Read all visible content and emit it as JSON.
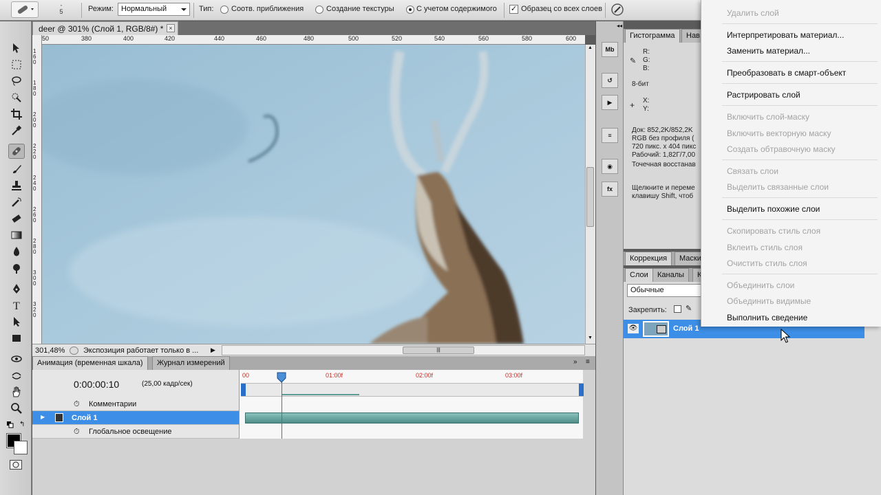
{
  "options_bar": {
    "brush_size": "5",
    "mode_label": "Режим:",
    "mode_value": "Нормальный",
    "type_label": "Тип:",
    "type_options": [
      "Соотв. приближения",
      "Создание текстуры",
      "С учетом содержимого"
    ],
    "sample_all_layers": "Образец со всех слоев"
  },
  "document": {
    "tab_title": "deer @ 301% (Слой 1, RGB/8#) *",
    "close_label": "×",
    "ruler_top": [
      "50",
      "380",
      "400",
      "420",
      "440",
      "460",
      "480",
      "500",
      "520",
      "540",
      "560",
      "580",
      "600"
    ],
    "ruler_left": [
      "160",
      "180",
      "200",
      "220",
      "240",
      "260",
      "280",
      "300",
      "320"
    ],
    "zoom": "301,48%",
    "status_text": "Экспозиция работает только в ..."
  },
  "timeline": {
    "tabs": [
      "Анимация (временная шкала)",
      "Журнал измерений"
    ],
    "time": "0:00:00:10",
    "fps": "(25,00 кадр/сек)",
    "ruler": [
      "00",
      "01:00f",
      "02:00f",
      "03:00f"
    ],
    "rows": {
      "comments": "Комментарии",
      "layer": "Слой 1",
      "global_light": "Глобальное освещение"
    }
  },
  "right_panel": {
    "tabs_top": [
      "Гистограмма",
      "Нав"
    ],
    "info": {
      "r": "R:",
      "g": "G:",
      "b": "B:",
      "bits": "8-бит",
      "x": "X:",
      "y": "Y:",
      "doc": "Док: 852,2K/852,2K",
      "profile": "RGB без профиля (",
      "size": "720 пикс. x 404 пикс",
      "work": "Рабочий: 1,82Г/7,00",
      "tool": "Точечная восстанав",
      "hint1": "Щелкните и переме",
      "hint2": "клавишу Shift, чтоб"
    },
    "adj_tabs": [
      "Коррекция",
      "Маски"
    ],
    "layers_tabs": [
      "Слои",
      "Каналы",
      "К"
    ],
    "blend_mode": "Обычные",
    "lock_label": "Закрепить:",
    "layer_name": "Слой 1"
  },
  "context_menu": {
    "items": [
      {
        "label": "Удалить слой",
        "disabled": true
      },
      {
        "label": "Интерпретировать материал...",
        "disabled": false
      },
      {
        "label": "Заменить материал...",
        "disabled": false
      },
      {
        "label": "Преобразовать в смарт-объект",
        "disabled": false
      },
      {
        "label": "Растрировать слой",
        "disabled": false
      },
      {
        "label": "Включить слой-маску",
        "disabled": true
      },
      {
        "label": "Включить векторную маску",
        "disabled": true
      },
      {
        "label": "Создать обтравочную маску",
        "disabled": true
      },
      {
        "label": "Связать слои",
        "disabled": true
      },
      {
        "label": "Выделить связанные слои",
        "disabled": true
      },
      {
        "label": "Выделить похожие слои",
        "disabled": false
      },
      {
        "label": "Скопировать стиль слоя",
        "disabled": true
      },
      {
        "label": "Вклеить стиль слоя",
        "disabled": true
      },
      {
        "label": "Очистить стиль слоя",
        "disabled": true
      },
      {
        "label": "Объединить слои",
        "disabled": true
      },
      {
        "label": "Объединить видимые",
        "disabled": true
      },
      {
        "label": "Выполнить сведение",
        "disabled": false
      }
    ]
  }
}
